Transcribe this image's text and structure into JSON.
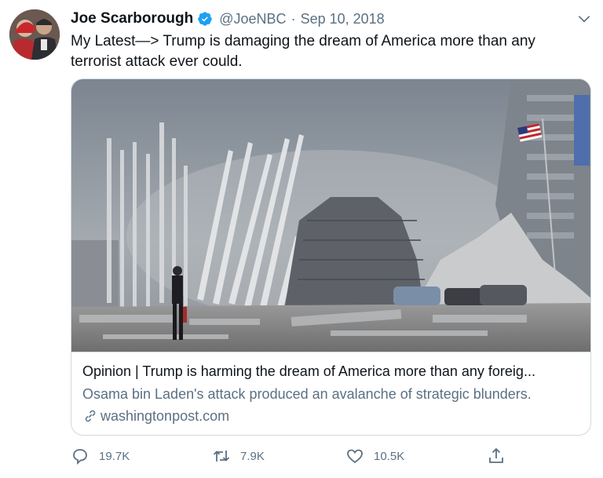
{
  "tweet": {
    "author_name": "Joe Scarborough",
    "handle": "@JoeNBC",
    "separator": "·",
    "date": "Sep 10, 2018",
    "text": "My Latest—> Trump is damaging the dream of America more than any terrorist attack ever could."
  },
  "card": {
    "title": "Opinion | Trump is harming the dream of America more than any foreig...",
    "description": "Osama bin Laden's attack produced an avalanche of strategic blunders.",
    "domain": "washingtonpost.com"
  },
  "actions": {
    "replies": "19.7K",
    "retweets": "7.9K",
    "likes": "10.5K"
  },
  "icons": {
    "verified": "verified-badge-icon",
    "more": "chevron-down-icon",
    "link": "link-icon",
    "reply": "reply-icon",
    "retweet": "retweet-icon",
    "like": "heart-icon",
    "share": "share-icon"
  },
  "colors": {
    "verified_blue": "#1da1f2",
    "muted_text": "#5b7083",
    "border": "#cfd9de"
  }
}
